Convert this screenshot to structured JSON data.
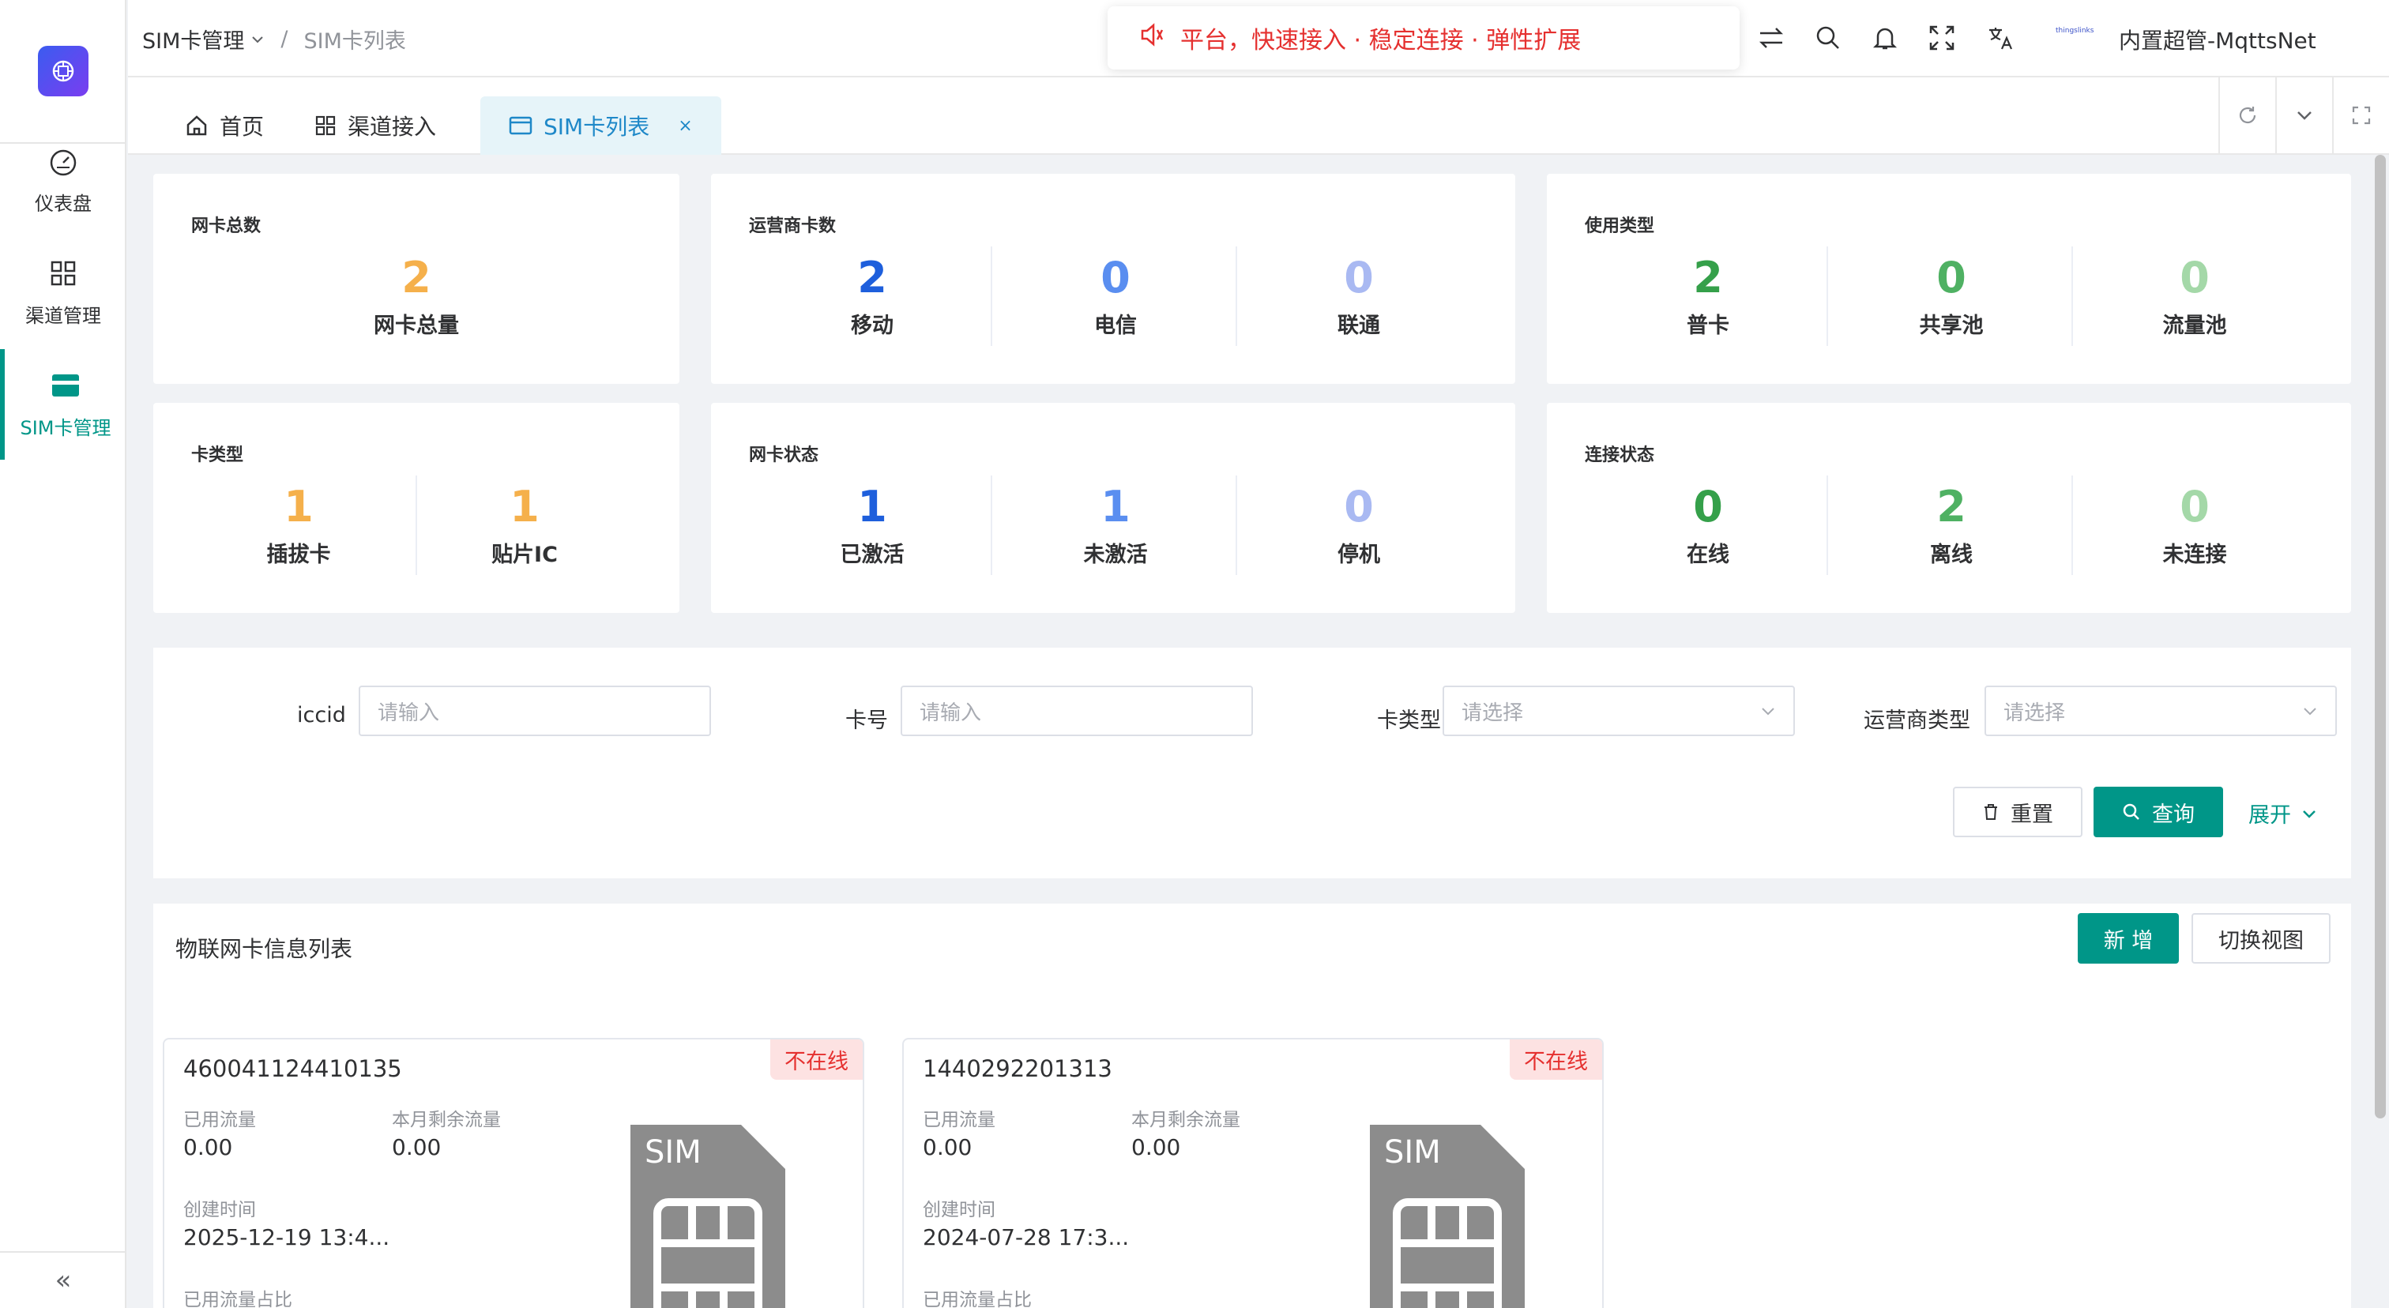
{
  "sidebar": {
    "items": [
      {
        "label": "仪表盘",
        "icon": "dashboard-icon"
      },
      {
        "label": "渠道管理",
        "icon": "grid-icon"
      },
      {
        "label": "SIM卡管理",
        "icon": "card-icon"
      }
    ],
    "collapse": "«"
  },
  "header": {
    "breadcrumb": [
      "SIM卡管理",
      "SIM卡列表"
    ],
    "breadcrumb_sep": "/",
    "notice": "平台，快速接入 · 稳定连接 · 弹性扩展",
    "mini_logo": "thingslinks",
    "user": "内置超管-MqttsNet"
  },
  "tabs": [
    {
      "label": "首页",
      "icon": "home-icon"
    },
    {
      "label": "渠道接入",
      "icon": "grid-icon"
    },
    {
      "label": "SIM卡列表",
      "icon": "card-icon",
      "close": "×"
    }
  ],
  "stats": {
    "total": {
      "title": "网卡总数",
      "items": [
        {
          "value": "2",
          "label": "网卡总量",
          "color": "#f5b04b"
        }
      ]
    },
    "operator": {
      "title": "运营商卡数",
      "items": [
        {
          "value": "2",
          "label": "移动",
          "color": "#1e5fdc"
        },
        {
          "value": "0",
          "label": "电信",
          "color": "#5a8ef0"
        },
        {
          "value": "0",
          "label": "联通",
          "color": "#a9b9f2"
        }
      ]
    },
    "usage": {
      "title": "使用类型",
      "items": [
        {
          "value": "2",
          "label": "普卡",
          "color": "#35a04a"
        },
        {
          "value": "0",
          "label": "共享池",
          "color": "#4fb163"
        },
        {
          "value": "0",
          "label": "流量池",
          "color": "#a4d8a8"
        }
      ]
    },
    "cardtype": {
      "title": "卡类型",
      "items": [
        {
          "value": "1",
          "label": "插拔卡",
          "color": "#f5b04b"
        },
        {
          "value": "1",
          "label": "贴片IC",
          "color": "#f5b04b"
        }
      ]
    },
    "status": {
      "title": "网卡状态",
      "items": [
        {
          "value": "1",
          "label": "已激活",
          "color": "#1e5fdc"
        },
        {
          "value": "1",
          "label": "未激活",
          "color": "#5a8ef0"
        },
        {
          "value": "0",
          "label": "停机",
          "color": "#a9b9f2"
        }
      ]
    },
    "connect": {
      "title": "连接状态",
      "items": [
        {
          "value": "0",
          "label": "在线",
          "color": "#35a04a"
        },
        {
          "value": "2",
          "label": "离线",
          "color": "#4fb163"
        },
        {
          "value": "0",
          "label": "未连接",
          "color": "#a4d8a8"
        }
      ]
    }
  },
  "search": {
    "iccid_label": "iccid",
    "iccid_placeholder": "请输入",
    "card_label": "卡号",
    "card_placeholder": "请输入",
    "type_label": "卡类型",
    "type_placeholder": "请选择",
    "operator_label": "运营商类型",
    "operator_placeholder": "请选择",
    "reset": "重置",
    "query": "查询",
    "expand": "展开"
  },
  "list": {
    "title": "物联网卡信息列表",
    "add": "新 增",
    "switch_view": "切换视图",
    "cards": [
      {
        "iccid": "460041124410135",
        "badge": "不在线",
        "used_label": "已用流量",
        "used": "0.00",
        "remain_label": "本月剩余流量",
        "remain": "0.00",
        "created_label": "创建时间",
        "created": "2025-12-19 13:4...",
        "ratio_label": "已用流量占比",
        "sim_text": "SIM"
      },
      {
        "iccid": "1440292201313",
        "badge": "不在线",
        "used_label": "已用流量",
        "used": "0.00",
        "remain_label": "本月剩余流量",
        "remain": "0.00",
        "created_label": "创建时间",
        "created": "2024-07-28 17:3...",
        "ratio_label": "已用流量占比",
        "sim_text": "SIM"
      }
    ]
  },
  "colors": {
    "primary": "#009688",
    "tab_active": "#1e88c8",
    "offline": "#e5302f"
  }
}
